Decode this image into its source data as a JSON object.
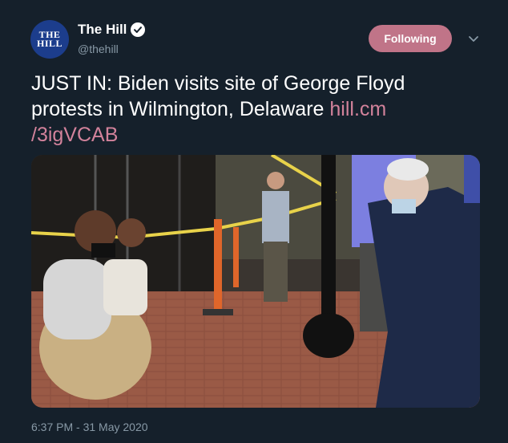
{
  "account": {
    "avatar_text_line1": "THE",
    "avatar_text_line2": "HILL",
    "display_name": "The Hill",
    "handle": "@thehill"
  },
  "follow_button": {
    "label": "Following"
  },
  "tweet": {
    "text": "JUST IN: Biden visits site of George Floyd protests in Wilmington, Delaware ",
    "link_part1": "hill.cm",
    "link_part2": "/3igVCAB",
    "timestamp": "6:37 PM - 31 May 2020"
  },
  "colors": {
    "background": "#15202b",
    "accent": "#c07488",
    "link": "#d2829b",
    "muted": "#8899a6"
  },
  "icons": {
    "verified": "verified-badge-icon",
    "more": "chevron-down-icon"
  }
}
